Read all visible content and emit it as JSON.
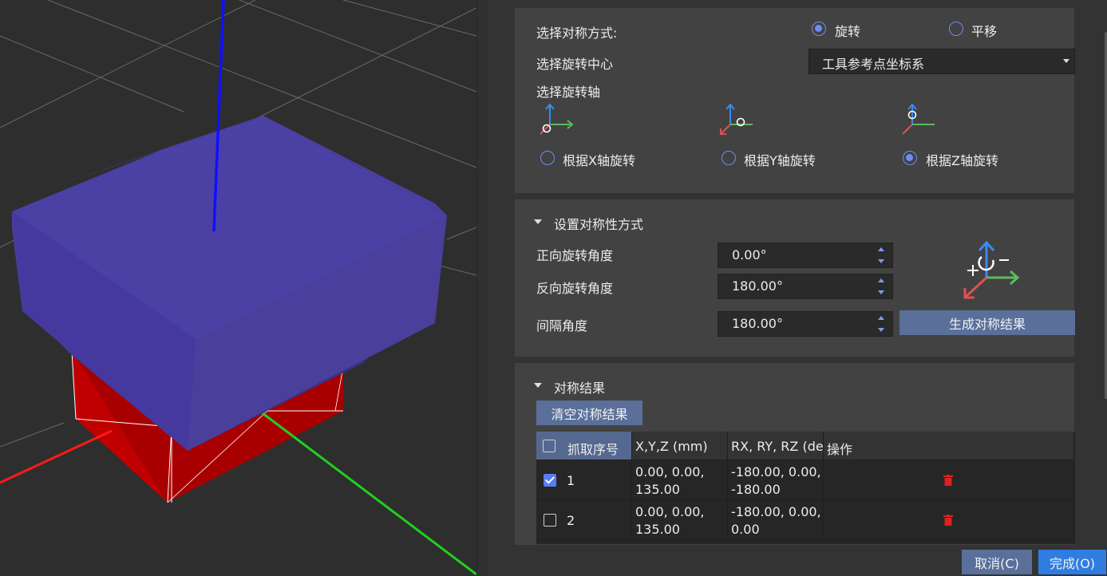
{
  "symmetry_method": {
    "label": "选择对称方式:",
    "options": [
      {
        "label": "旋转",
        "selected": true
      },
      {
        "label": "平移",
        "selected": false
      }
    ]
  },
  "rotation_center": {
    "label": "选择旋转中心",
    "value": "工具参考点坐标系"
  },
  "rotation_axis": {
    "label": "选择旋转轴",
    "options": [
      {
        "label": "根据X轴旋转",
        "selected": false,
        "icon": "x-axis-rotation-icon"
      },
      {
        "label": "根据Y轴旋转",
        "selected": false,
        "icon": "y-axis-rotation-icon"
      },
      {
        "label": "根据Z轴旋转",
        "selected": true,
        "icon": "z-axis-rotation-icon"
      }
    ]
  },
  "symmetry_settings": {
    "title": "设置对称性方式",
    "forward_angle": {
      "label": "正向旋转角度",
      "value": "0.00°"
    },
    "reverse_angle": {
      "label": "反向旋转角度",
      "value": "180.00°"
    },
    "interval_angle": {
      "label": "间隔角度",
      "value": "180.00°"
    },
    "generate_button": "生成对称结果"
  },
  "results": {
    "title": "对称结果",
    "clear_button": "清空对称结果",
    "columns": [
      "抓取序号",
      "X,Y,Z (mm)",
      "RX, RY, RZ (de",
      "操作"
    ],
    "rows": [
      {
        "checked": true,
        "index": "1",
        "xyz": "0.00, 0.00,\n135.00",
        "rxryrz": "-180.00, 0.00,\n-180.00"
      },
      {
        "checked": false,
        "index": "2",
        "xyz": "0.00, 0.00,\n135.00",
        "rxryrz": "-180.00, 0.00,\n0.00"
      }
    ]
  },
  "footer": {
    "cancel": "取消(C)",
    "done": "完成(O)"
  },
  "colors": {
    "accent": "#6f8cf0",
    "button": "#5a6f9a",
    "primary": "#2f7de0",
    "object_top": "#4a3f9a",
    "object_base": "#b00000",
    "axis_x": "#ff2020",
    "axis_y": "#20d020",
    "axis_z": "#1010ff"
  }
}
